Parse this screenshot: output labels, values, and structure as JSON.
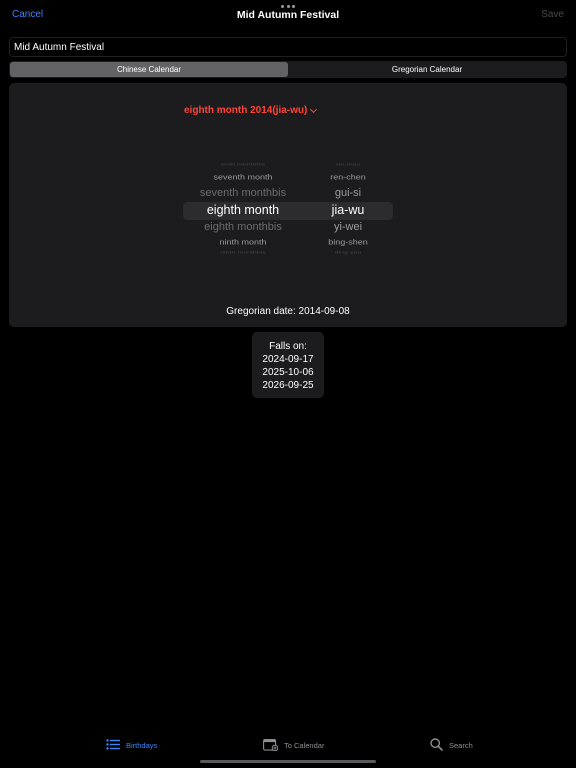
{
  "nav": {
    "cancel_label": "Cancel",
    "title": "Mid Autumn Festival",
    "save_label": "Save"
  },
  "event": {
    "name_value": "Mid Autumn Festival"
  },
  "calendar_segment": {
    "options": [
      "Chinese Calendar",
      "Gregorian Calendar"
    ],
    "selected": "Chinese Calendar"
  },
  "picker": {
    "header_label": "eighth month 2014(jia-wu)",
    "month_column": [
      "sixth monthbis",
      "seventh month",
      "seventh monthbis",
      "eighth month",
      "eighth monthbis",
      "ninth month",
      "ninth monthbis"
    ],
    "year_column": [
      "xin-mao",
      "ren-chen",
      "gui-si",
      "jia-wu",
      "yi-wei",
      "bing-shen",
      "ding-you"
    ],
    "selected_month": "eighth month",
    "selected_year": "jia-wu"
  },
  "gregorian_date": "Gregorian date: 2014-09-08",
  "falls_on": {
    "label": "Falls on:",
    "dates": [
      "2024-09-17",
      "2025-10-06",
      "2026-09-25"
    ]
  },
  "tabbar": {
    "items": [
      {
        "label": "Birthdays",
        "icon": "list-icon",
        "active": true
      },
      {
        "label": "To Calendar",
        "icon": "calendar-add-icon",
        "active": false
      },
      {
        "label": "Search",
        "icon": "search-icon",
        "active": false
      }
    ]
  },
  "colors": {
    "accent": "#3b86f7",
    "header_red": "#ff453a",
    "card_bg": "#1c1c1e",
    "active_segment": "#636366"
  }
}
